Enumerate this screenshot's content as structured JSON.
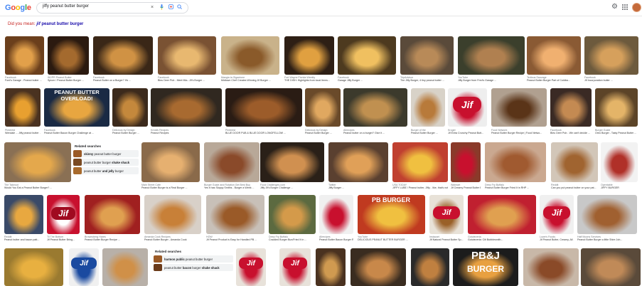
{
  "header": {
    "logo": "Google",
    "query": "jiffy peanut butter burger"
  },
  "did_you_mean": {
    "prefix": "Did you mean:",
    "bold_word": "jif",
    "rest": "peanut butter burger"
  },
  "related_1": {
    "title": "Related searches",
    "items": [
      {
        "bold": "skinny",
        "rest": "peanut butter burger"
      },
      {
        "bold": "",
        "rest": "peanut butter burger",
        "bold2": "shake shack"
      },
      {
        "bold": "",
        "rest": "peanut butter",
        "bold2": "and jelly",
        "rest2": "burger"
      }
    ]
  },
  "related_2": {
    "title": "Related searches",
    "items": [
      {
        "bold": "harmon public",
        "rest": "peanut butter burger"
      },
      {
        "bold": "",
        "rest": "peanut butter",
        "bold2": "bacon",
        "rest2": "burger",
        "bold3": "shake shack"
      }
    ]
  },
  "overlay_texts": {
    "overload": "PEANUT BUTTER OVERLOAD!",
    "jif": "Jif",
    "pbburger": "PB BURGER",
    "pbj": "PB&J",
    "pbj2": "BURGER"
  },
  "rows": [
    [
      {
        "src": "Facebook",
        "title": "Ford's Garage - Peanut butter ..."
      },
      {
        "src": "WVPR Peanut Butter",
        "title": "Spicer / Peanut Butter Burger ..."
      },
      {
        "src": "Facebook",
        "title": "Peanut Butter on a Burger? It's ..."
      },
      {
        "src": "Facebook",
        "title": "Bleu Deer Pub - Meet Mia...Jif's Burger ..."
      },
      {
        "src": "Mangia la Gigantone",
        "title": "Midtown Chef Creates Winning Jif Burger ..."
      },
      {
        "src": "Fort Wayne Florida Weekly",
        "title": "THE DISH: Highlights from local Items..."
      },
      {
        "src": "Facebook",
        "title": "Garage Jiffy Burger ..."
      },
      {
        "src": "TripAdvisor",
        "title": "The Jiffy Burger, 4 tiny peanut butter ..."
      },
      {
        "src": "YouTube",
        "title": "Jiffy Burger from Fred's Garage ..."
      },
      {
        "src": "Tedious Sauvage",
        "title": "Peanut Butter Burger Part of Coldba..."
      },
      {
        "src": "Facebook",
        "title": "Jif Incorporation butter ..."
      }
    ],
    [
      {
        "src": "Pinterest",
        "title": "Wendale ... Jiffy peanut butter ..."
      },
      {
        "src": "Facebook",
        "title": "Peanut Butter Bacon Burger Challenge at ..."
      },
      {
        "src": "Delicious by Design",
        "title": "Peanut Butter Burger ..."
      },
      {
        "src": "Kreativ Recipes",
        "title": "Peanut Recipes"
      },
      {
        "src": "Pinterest",
        "title": "BLUE DOOR PUB & BLUE DOOR LONGFELLOW ..."
      },
      {
        "src": "Delicious by Design",
        "title": "Peanut Butter Burger ..."
      },
      {
        "src": "Allrecipes",
        "title": "Peanut butter on a burger? Give it ..."
      },
      {
        "src": "Burger of the",
        "title": "Peanut Butter Burger ..."
      },
      {
        "src": "Kroger",
        "title": "Jif Extra Crunchy Peanut Butt..."
      },
      {
        "src": "Food Network",
        "title": "Peanut Butter Burger Recipe | Food Netwo..."
      },
      {
        "src": "Facebook",
        "title": "Bleu Deer Pub - We can't decide ..."
      },
      {
        "src": "Burger Guide",
        "title": "Oreo Burger - Tasty Peanut Butter ..."
      }
    ],
    [
      {
        "src": "The Takeout",
        "title": "Would You Eat a Peanut Butter Burger? ..."
      },
      {
        "src": "Main Street Cafe",
        "title": "Peanut Butter Burger is a Real Burger ..."
      },
      {
        "src": "Burger Guide and Rotation Get Best Buy",
        "title": "Yes it has Sloppy Smiths - Burger a Week ..."
      },
      {
        "src": "Food Challenges.com",
        "title": "Jiffy Jif's Burger Challenge ..."
      },
      {
        "src": "Twitter",
        "title": "Jiffy Burger ..."
      },
      {
        "src": "USA TODAY",
        "title": "JIFFY LUBE / Peanut butter, Jiffy... like, that's not ..."
      },
      {
        "src": "Walmart",
        "title": "Jif Creamy Peanut Butter Bu..."
      },
      {
        "src": "Deep Fry Buffalo",
        "title": "Peanut Butter Burger Fried It in RHP ..."
      },
      {
        "src": "Reddit",
        "title": "Can you put peanut butter on your pat..."
      },
      {
        "src": "Opentable",
        "title": "JIFFY BURGER"
      }
    ],
    [
      {
        "src": "Reddit",
        "title": "Peanut butter and bacon patt..."
      },
      {
        "src": "Til The Bottom",
        "title": "Jif Peanut Butter Bring..."
      },
      {
        "src": "Brownsberg Hares",
        "title": "Peanut Butter Burger Recipe ..."
      },
      {
        "src": "Amanda Cook Recipes",
        "title": "Peanut Butter Burger - Amanda Cook"
      },
      {
        "src": "HOW",
        "title": "Jif Peanut Product is Easy for Handled PB ..."
      },
      {
        "src": "Deep Fry Buffalo",
        "title": "Crackled Burger Bun/Fried It in ..."
      },
      {
        "src": "Allrecipes",
        "title": "Peanut Butter Bacon Burger Recipe ..."
      },
      {
        "src": "YouTube",
        "title": "DELICIOUS PEANUT BUTTER BURGER ..."
      },
      {
        "src": "Instacart",
        "title": "Jif Natural Peanut Butter Sp..."
      },
      {
        "src": "Gotuteveria",
        "title": "Gotuteveria: Citi Bubblesmith..."
      },
      {
        "src": "Lowe's Foods",
        "title": "Jif Peanut Butter, Creamy, All ..."
      },
      {
        "src": "Half Moons Services",
        "title": "Peanut Butter Burger a little Shire Joh..."
      }
    ],
    [
      {
        "src": "",
        "title": ""
      },
      {
        "src": "",
        "title": ""
      },
      {
        "src": "",
        "title": ""
      },
      {
        "src": "",
        "title": ""
      },
      {
        "src": "",
        "title": ""
      },
      {
        "src": "",
        "title": ""
      },
      {
        "src": "",
        "title": ""
      },
      {
        "src": "",
        "title": ""
      },
      {
        "src": "",
        "title": ""
      },
      {
        "src": "",
        "title": ""
      },
      {
        "src": "",
        "title": ""
      }
    ]
  ],
  "colors": {
    "blue": "#4285f4",
    "red": "#ea4335",
    "yellow": "#fbbc05",
    "green": "#34a853",
    "jif_red": "#c8102e",
    "link": "#1a0dab"
  }
}
